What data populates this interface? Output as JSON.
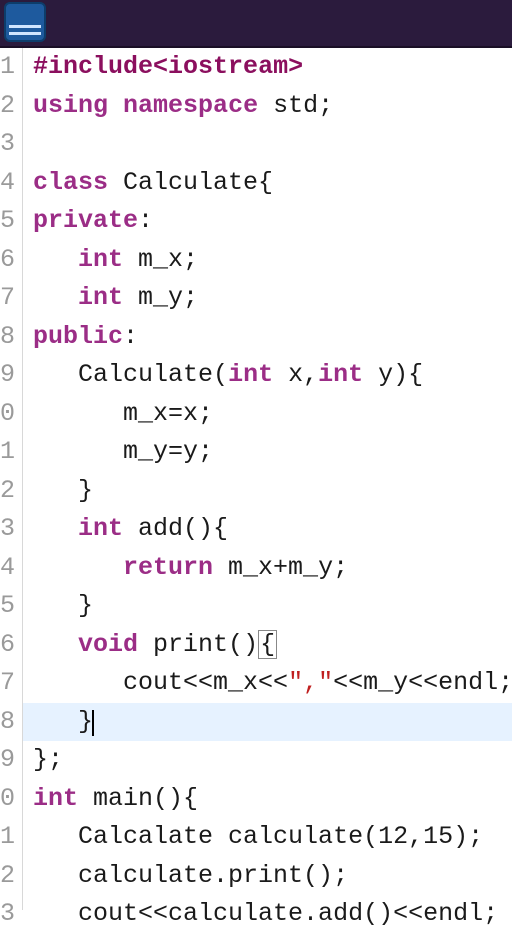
{
  "topbar": {},
  "gutter": {
    "lines": [
      "1",
      "2",
      "3",
      "4",
      "5",
      "6",
      "7",
      "8",
      "9",
      "0",
      "1",
      "2",
      "3",
      "4",
      "5",
      "6",
      "7",
      "8",
      "9",
      "0",
      "1",
      "2",
      "3"
    ]
  },
  "code": {
    "highlight_line_index": 17,
    "lines": [
      {
        "tokens": [
          {
            "t": "preproc",
            "v": "#include"
          },
          {
            "t": "include-path",
            "v": "<iostream>"
          }
        ]
      },
      {
        "tokens": [
          {
            "t": "kw",
            "v": "using"
          },
          {
            "t": "punc",
            "v": " "
          },
          {
            "t": "kw",
            "v": "namespace"
          },
          {
            "t": "punc",
            "v": " std;"
          }
        ]
      },
      {
        "tokens": []
      },
      {
        "tokens": [
          {
            "t": "kw",
            "v": "class"
          },
          {
            "t": "punc",
            "v": " Calculate{"
          }
        ]
      },
      {
        "tokens": [
          {
            "t": "kw",
            "v": "private"
          },
          {
            "t": "punc",
            "v": ":"
          }
        ]
      },
      {
        "tokens": [
          {
            "t": "punc",
            "v": "   "
          },
          {
            "t": "type",
            "v": "int"
          },
          {
            "t": "punc",
            "v": " m_x;"
          }
        ]
      },
      {
        "tokens": [
          {
            "t": "punc",
            "v": "   "
          },
          {
            "t": "type",
            "v": "int"
          },
          {
            "t": "punc",
            "v": " m_y;"
          }
        ]
      },
      {
        "tokens": [
          {
            "t": "kw",
            "v": "public"
          },
          {
            "t": "punc",
            "v": ":"
          }
        ]
      },
      {
        "tokens": [
          {
            "t": "punc",
            "v": "   Calculate("
          },
          {
            "t": "type",
            "v": "int"
          },
          {
            "t": "punc",
            "v": " x,"
          },
          {
            "t": "type",
            "v": "int"
          },
          {
            "t": "punc",
            "v": " y){"
          }
        ]
      },
      {
        "tokens": [
          {
            "t": "punc",
            "v": "      m_x=x;"
          }
        ]
      },
      {
        "tokens": [
          {
            "t": "punc",
            "v": "      m_y=y;"
          }
        ]
      },
      {
        "tokens": [
          {
            "t": "punc",
            "v": "   }"
          }
        ]
      },
      {
        "tokens": [
          {
            "t": "punc",
            "v": "   "
          },
          {
            "t": "type",
            "v": "int"
          },
          {
            "t": "punc",
            "v": " add(){"
          }
        ]
      },
      {
        "tokens": [
          {
            "t": "punc",
            "v": "      "
          },
          {
            "t": "kw",
            "v": "return"
          },
          {
            "t": "punc",
            "v": " m_x+m_y;"
          }
        ]
      },
      {
        "tokens": [
          {
            "t": "punc",
            "v": "   }"
          }
        ]
      },
      {
        "tokens": [
          {
            "t": "punc",
            "v": "   "
          },
          {
            "t": "type",
            "v": "void"
          },
          {
            "t": "punc",
            "v": " print()"
          },
          {
            "t": "box",
            "v": "{"
          }
        ]
      },
      {
        "tokens": [
          {
            "t": "punc",
            "v": "      cout<<m_x<<"
          },
          {
            "t": "str",
            "v": "\",\""
          },
          {
            "t": "punc",
            "v": "<<m_y<<endl;"
          }
        ]
      },
      {
        "tokens": [
          {
            "t": "punc",
            "v": "   }"
          },
          {
            "t": "caret",
            "v": ""
          }
        ]
      },
      {
        "tokens": [
          {
            "t": "punc",
            "v": "};"
          }
        ]
      },
      {
        "tokens": [
          {
            "t": "type",
            "v": "int"
          },
          {
            "t": "punc",
            "v": " main(){"
          }
        ]
      },
      {
        "tokens": [
          {
            "t": "punc",
            "v": "   Calcalate calculate(12,15);"
          }
        ]
      },
      {
        "tokens": [
          {
            "t": "punc",
            "v": "   calculate.print();"
          }
        ]
      },
      {
        "tokens": [
          {
            "t": "punc",
            "v": "   cout<<calculate.add()<<endl;"
          }
        ]
      }
    ]
  }
}
